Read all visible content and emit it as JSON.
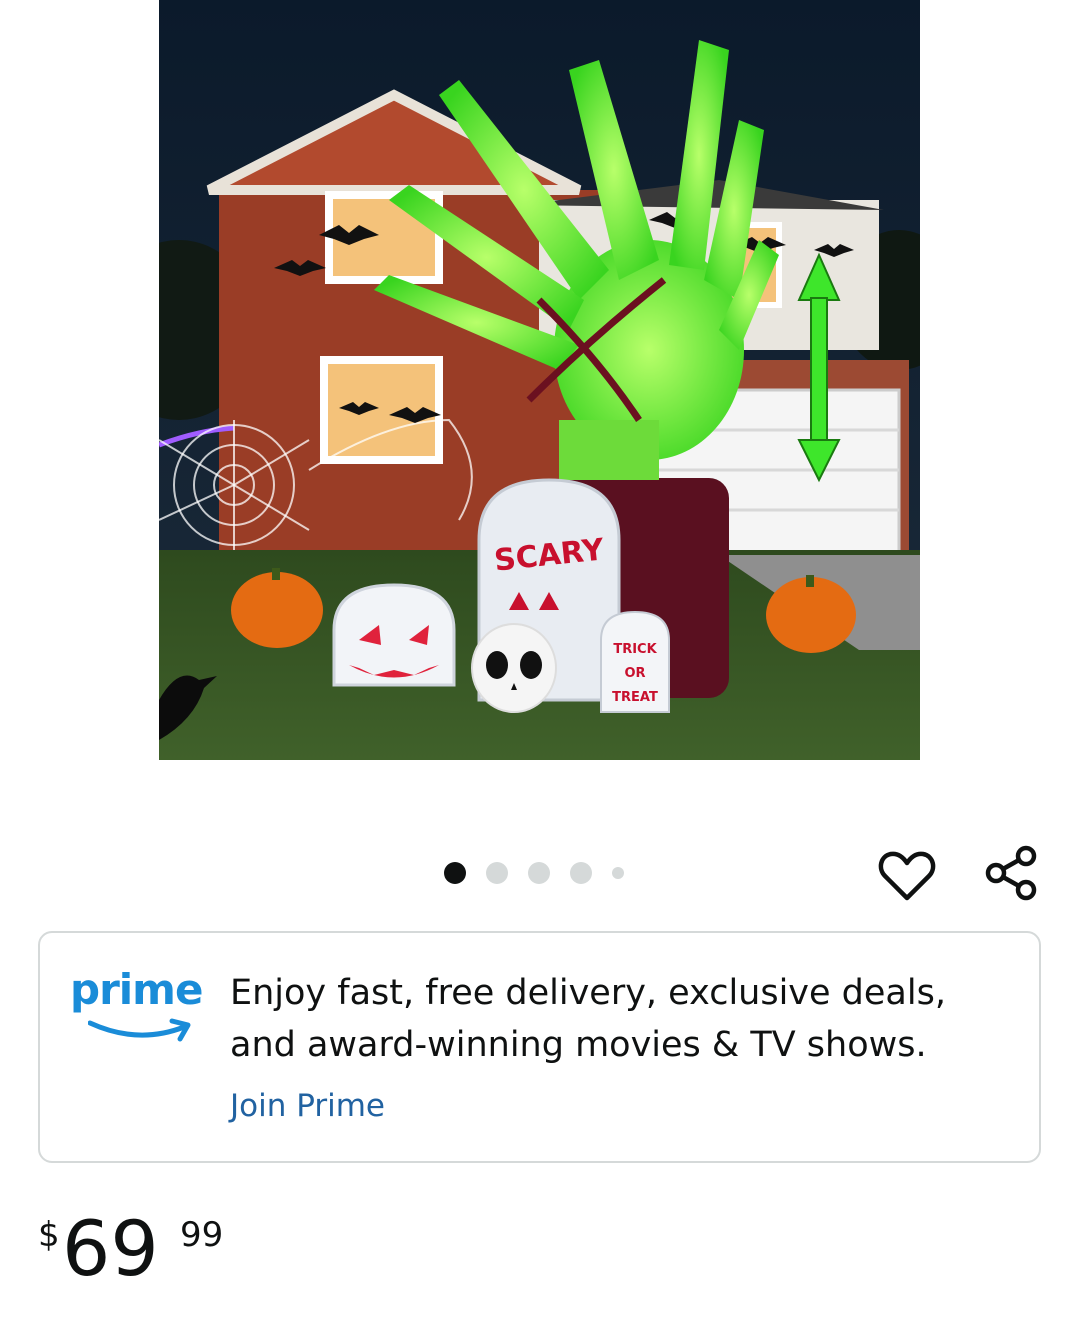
{
  "product": {
    "image_alt": "",
    "image_text": {
      "tombstone_main": "SCARY",
      "tombstone_small_line1": "TRICK",
      "tombstone_small_line2": "OR",
      "tombstone_small_line3": "TREAT"
    }
  },
  "carousel": {
    "total_dots": 5,
    "active_index": 0
  },
  "actions": {
    "favorite_icon": "heart-outline-icon",
    "share_icon": "share-icon"
  },
  "prime": {
    "logo_word": "prime",
    "message_line1": "Enjoy fast, free delivery, exclusive deals,",
    "message_line2": "and award-winning movies & TV shows.",
    "join_label": "Join Prime",
    "brand_color": "#1a8cd8",
    "link_color": "#2162a1"
  },
  "price": {
    "symbol": "$",
    "whole": "69",
    "fraction": "99"
  }
}
